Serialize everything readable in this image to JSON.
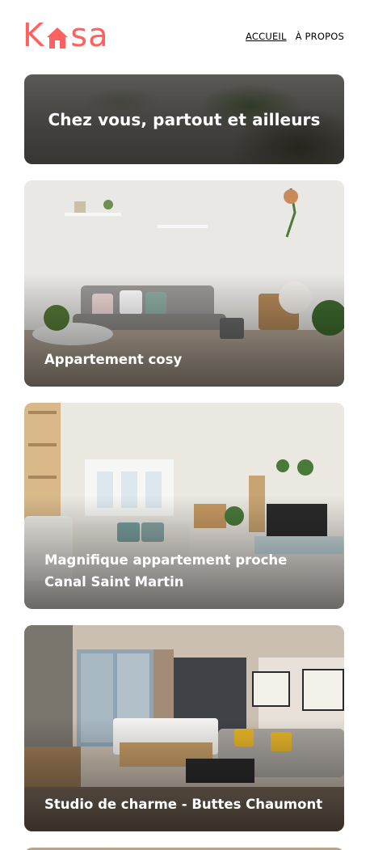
{
  "brand": {
    "logo_left": "K",
    "logo_right": "sa",
    "color": "#FF6060"
  },
  "nav": {
    "home_label": "ACCUEIL",
    "about_label": "À PROPOS"
  },
  "banner": {
    "title": "Chez vous, partout et ailleurs"
  },
  "listings": [
    {
      "title": "Appartement cosy"
    },
    {
      "title": "Magnifique appartement proche Canal Saint Martin"
    },
    {
      "title": "Studio de charme - Buttes Chaumont"
    }
  ]
}
